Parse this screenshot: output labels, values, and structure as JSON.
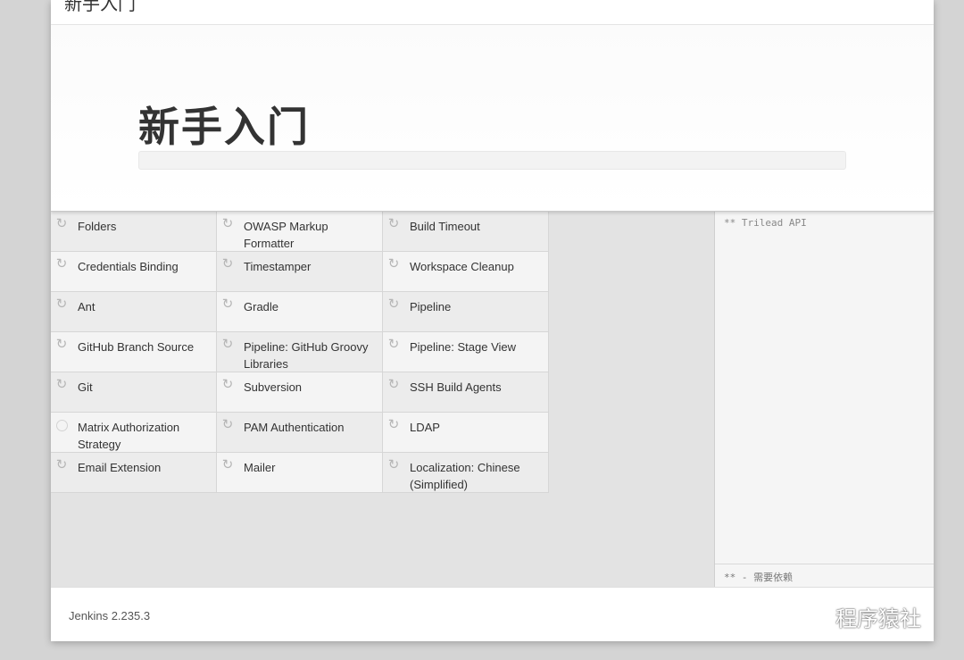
{
  "header": {
    "title": "新手入门"
  },
  "hero": {
    "title": "新手入门",
    "progress_fraction": 0.0
  },
  "plugins": [
    {
      "name": "Folders",
      "icon": "refresh-icon"
    },
    {
      "name": "OWASP Markup Formatter",
      "icon": "refresh-icon"
    },
    {
      "name": "Build Timeout",
      "icon": "refresh-icon"
    },
    {
      "name": "Credentials Binding",
      "icon": "refresh-icon"
    },
    {
      "name": "Timestamper",
      "icon": "refresh-icon"
    },
    {
      "name": "Workspace Cleanup",
      "icon": "refresh-icon"
    },
    {
      "name": "Ant",
      "icon": "refresh-icon"
    },
    {
      "name": "Gradle",
      "icon": "refresh-icon"
    },
    {
      "name": "Pipeline",
      "icon": "refresh-icon"
    },
    {
      "name": "GitHub Branch Source",
      "icon": "refresh-icon"
    },
    {
      "name": "Pipeline: GitHub Groovy Libraries",
      "icon": "refresh-icon"
    },
    {
      "name": "Pipeline: Stage View",
      "icon": "refresh-icon"
    },
    {
      "name": "Git",
      "icon": "refresh-icon"
    },
    {
      "name": "Subversion",
      "icon": "refresh-icon"
    },
    {
      "name": "SSH Build Agents",
      "icon": "refresh-icon"
    },
    {
      "name": "Matrix Authorization Strategy",
      "icon": "pending-circle-icon"
    },
    {
      "name": "PAM Authentication",
      "icon": "refresh-icon"
    },
    {
      "name": "LDAP",
      "icon": "refresh-icon"
    },
    {
      "name": "Email Extension",
      "icon": "refresh-icon"
    },
    {
      "name": "Mailer",
      "icon": "refresh-icon"
    },
    {
      "name": "Localization: Chinese (Simplified)",
      "icon": "refresh-icon"
    }
  ],
  "log": {
    "text": "** Trilead API",
    "footer": "** - 需要依赖"
  },
  "footer": {
    "version": "Jenkins 2.235.3"
  },
  "watermark": {
    "text": "程序猿社",
    "icon": "wechat-logo-icon"
  },
  "colors": {
    "backdrop": "#d4d4d4",
    "dialog_bg": "#ffffff",
    "plugin_area_bg": "#e3e3e3",
    "cell_bg": "#f4f4f4",
    "icon_gray": "#b5b5b5"
  }
}
